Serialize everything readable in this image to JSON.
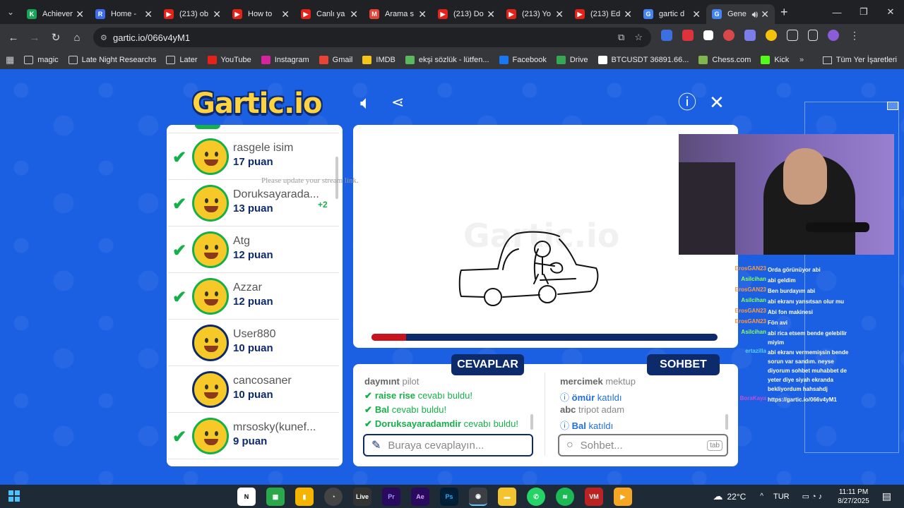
{
  "browser": {
    "tabs": [
      {
        "title": "Achievements",
        "favicon_color": "#18a558",
        "favicon_letter": "K"
      },
      {
        "title": "Home - ",
        "favicon_color": "#3b6cf2",
        "favicon_letter": "R"
      },
      {
        "title": "(213) ob",
        "favicon_color": "#e62117",
        "favicon_letter": "▶"
      },
      {
        "title": "How to ",
        "favicon_color": "#e62117",
        "favicon_letter": "▶"
      },
      {
        "title": "Canlı ya",
        "favicon_color": "#e62117",
        "favicon_letter": "▶"
      },
      {
        "title": "Arama s",
        "favicon_color": "#ea4335",
        "favicon_letter": "M"
      },
      {
        "title": "(213) Do",
        "favicon_color": "#e62117",
        "favicon_letter": "▶"
      },
      {
        "title": "(213) Yo",
        "favicon_color": "#e62117",
        "favicon_letter": "▶"
      },
      {
        "title": "(213) Ed",
        "favicon_color": "#e62117",
        "favicon_letter": "▶"
      },
      {
        "title": "gartic d",
        "favicon_color": "#4285f4",
        "favicon_letter": "G"
      },
      {
        "title": "Gene",
        "favicon_color": "#4285f4",
        "favicon_letter": "G",
        "active": true
      }
    ],
    "url": "gartic.io/066v4yM1",
    "bookmarks": [
      {
        "label": "magic",
        "type": "folder"
      },
      {
        "label": "Late Night Researchs",
        "type": "folder"
      },
      {
        "label": "Later",
        "type": "folder"
      },
      {
        "label": "YouTube",
        "type": "site",
        "color": "#e62117"
      },
      {
        "label": "Instagram",
        "type": "site",
        "color": "#d6249f"
      },
      {
        "label": "Gmail",
        "type": "site",
        "color": "#ea4335"
      },
      {
        "label": "IMDB",
        "type": "site",
        "color": "#f5c518"
      },
      {
        "label": "ekşi sözlük - lütfen...",
        "type": "site",
        "color": "#5cb85c"
      },
      {
        "label": "Facebook",
        "type": "site",
        "color": "#1877f2"
      },
      {
        "label": "Drive",
        "type": "site",
        "color": "#34a853"
      },
      {
        "label": "BTCUSDT 36891.66...",
        "type": "site",
        "color": "#ffffff"
      },
      {
        "label": "Chess.com",
        "type": "site",
        "color": "#81b64c"
      },
      {
        "label": "Kick",
        "type": "site",
        "color": "#53fc18"
      }
    ],
    "all_bookmarks": "Tüm Yer İşaretleri"
  },
  "game": {
    "logo": "Gartic.io",
    "players": [
      {
        "name": "rasgele isim",
        "score": "17 puan",
        "guessed": true
      },
      {
        "name": "Doruksayarada...",
        "score": "13 puan",
        "guessed": true,
        "bonus": "+2"
      },
      {
        "name": "Atg",
        "score": "12 puan",
        "guessed": true
      },
      {
        "name": "Azzar",
        "score": "12 puan",
        "guessed": true
      },
      {
        "name": "User880",
        "score": "10 puan",
        "guessed": false
      },
      {
        "name": "cancosaner",
        "score": "10 puan",
        "guessed": false
      },
      {
        "name": "mrsosky(kunef...",
        "score": "9 puan",
        "guessed": true
      }
    ],
    "stream_note": "Please update your stream link.",
    "canvas_watermark": "Gartic.io",
    "timer_progress": 0.1,
    "answers_tab": "CEVAPLAR",
    "chat_tab": "SOHBET",
    "answers": [
      {
        "user": "daymınt",
        "text": "pilot",
        "correct": false
      },
      {
        "user": "raise rise",
        "text": "cevabı buldu!",
        "correct": true
      },
      {
        "user": "Bal",
        "text": "cevabı buldu!",
        "correct": true
      },
      {
        "user": "Doruksayaradamdir",
        "text": "cevabı buldu!",
        "correct": true
      }
    ],
    "chat": [
      {
        "user": "mercimek",
        "text": "mektup",
        "system": false
      },
      {
        "user": "ömür",
        "text": "katıldı",
        "system": true
      },
      {
        "user": "abc",
        "text": "tripot adam",
        "system": false
      },
      {
        "user": "Bal",
        "text": "katıldı",
        "system": true
      }
    ],
    "answer_placeholder": "Buraya cevaplayın...",
    "chat_placeholder": "Sohbet...",
    "tab_key": "tab"
  },
  "stream_chat": [
    {
      "user": "ErosGAN23",
      "msg": "Orda görünüyor abi",
      "color": "#ff9a3c"
    },
    {
      "user": "Asilcihan",
      "msg": "abi geldim",
      "color": "#8cff5a"
    },
    {
      "user": "ErosGAN23",
      "msg": "Ben burdayım abi",
      "color": "#ff9a3c"
    },
    {
      "user": "Asilcihan",
      "msg": "abi ekranı yansıtsan olur mu",
      "color": "#8cff5a"
    },
    {
      "user": "ErosGAN23",
      "msg": "Abi fon makinesi",
      "color": "#ff9a3c"
    },
    {
      "user": "ErosGAN23",
      "msg": "Fön avi",
      "color": "#ff9a3c"
    },
    {
      "user": "Asilcihan",
      "msg": "abi rica etsem bende gelebilir miyim",
      "color": "#8cff5a"
    },
    {
      "user": "ertazilla",
      "msg": "abi ekranı vermemişsin bende sorun var sandım. neyse diyorum sohbet muhabbet de yeter diye siyah ekranda bekliyordum hahsahdj",
      "color": "#5ad0ff"
    },
    {
      "user": "BoraKaya",
      "msg": "https://gartic.io/066v4yM1",
      "color": "#c04fd8"
    }
  ],
  "taskbar": {
    "weather": "22°C",
    "lang": "TUR",
    "time": "11:11 PM",
    "date": "8/27/2025"
  }
}
